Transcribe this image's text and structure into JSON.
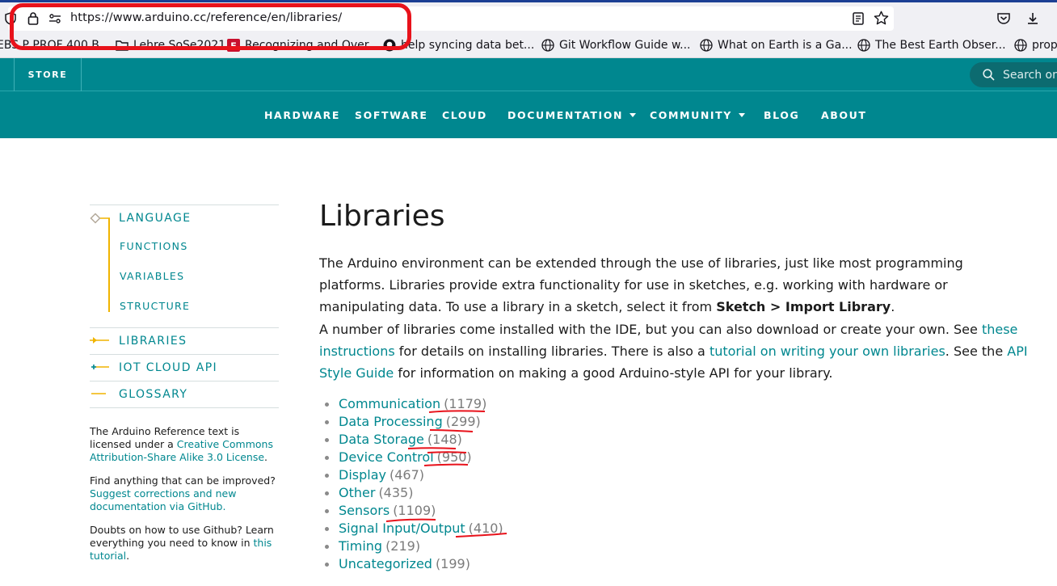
{
  "browser": {
    "url": "https://www.arduino.cc/reference/en/libraries/",
    "bookmarks": [
      "EBS P PROF 400 B...",
      "Lehre SoSe2021",
      "Recognizing and Over...",
      "help syncing data bet...",
      "Git Workflow Guide w...",
      "What on Earth is a Ga...",
      "The Best Earth Obser...",
      "prop"
    ]
  },
  "site_header": {
    "store_label": "STORE",
    "search_placeholder": "Search on"
  },
  "nav": {
    "items": [
      "HARDWARE",
      "SOFTWARE",
      "CLOUD",
      "DOCUMENTATION",
      "COMMUNITY",
      "BLOG",
      "ABOUT"
    ]
  },
  "sidebar": {
    "language": "LANGUAGE",
    "sub_items": [
      "FUNCTIONS",
      "VARIABLES",
      "STRUCTURE"
    ],
    "libraries": "LIBRARIES",
    "iot_cloud_api": "IOT CLOUD API",
    "glossary": "GLOSSARY",
    "license_text": "The Arduino Reference text is licensed under a",
    "license_link": "Creative Commons Attribution-Share Alike 3.0 License",
    "license_end": ".",
    "improve_text": "Find anything that can be improved?",
    "improve_link": "Suggest corrections and new documentation via GitHub.",
    "github_text": "Doubts on how to use Github? Learn everything you need to know in",
    "github_link": "this tutorial",
    "github_end": "."
  },
  "main": {
    "title": "Libraries",
    "p1": "The Arduino environment can be extended through the use of libraries, just like most programming platforms. Libraries provide extra functionality for use in sketches, e.g. working with hardware or manipulating data. To use a library in a sketch, select it from ",
    "p1_bold": "Sketch > Import Library",
    "p1_end": ".",
    "p2_a": "A number of libraries come installed with the IDE, but you can also download or create your own. See ",
    "p2_link1": "these instructions",
    "p2_b": " for details on installing libraries. There is also a ",
    "p2_link2": "tutorial on writing your own libraries",
    "p2_c": ". See the ",
    "p2_link3": "API Style Guide",
    "p2_d": " for information on making a good Arduino-style API for your library.",
    "categories": [
      {
        "name": "Communication",
        "count": "(1179)"
      },
      {
        "name": "Data Processing",
        "count": "(299)"
      },
      {
        "name": "Data Storage",
        "count": "(148)"
      },
      {
        "name": "Device Control",
        "count": "(950)"
      },
      {
        "name": "Display",
        "count": "(467)"
      },
      {
        "name": "Other",
        "count": "(435)"
      },
      {
        "name": "Sensors",
        "count": "(1109)"
      },
      {
        "name": "Signal Input/Output",
        "count": "(410)"
      },
      {
        "name": "Timing",
        "count": "(219)"
      },
      {
        "name": "Uncategorized",
        "count": "(199)"
      }
    ]
  },
  "colors": {
    "brand_teal": "#00878f",
    "accent_yellow": "#f0b400",
    "annotation_red": "#e8121b"
  }
}
